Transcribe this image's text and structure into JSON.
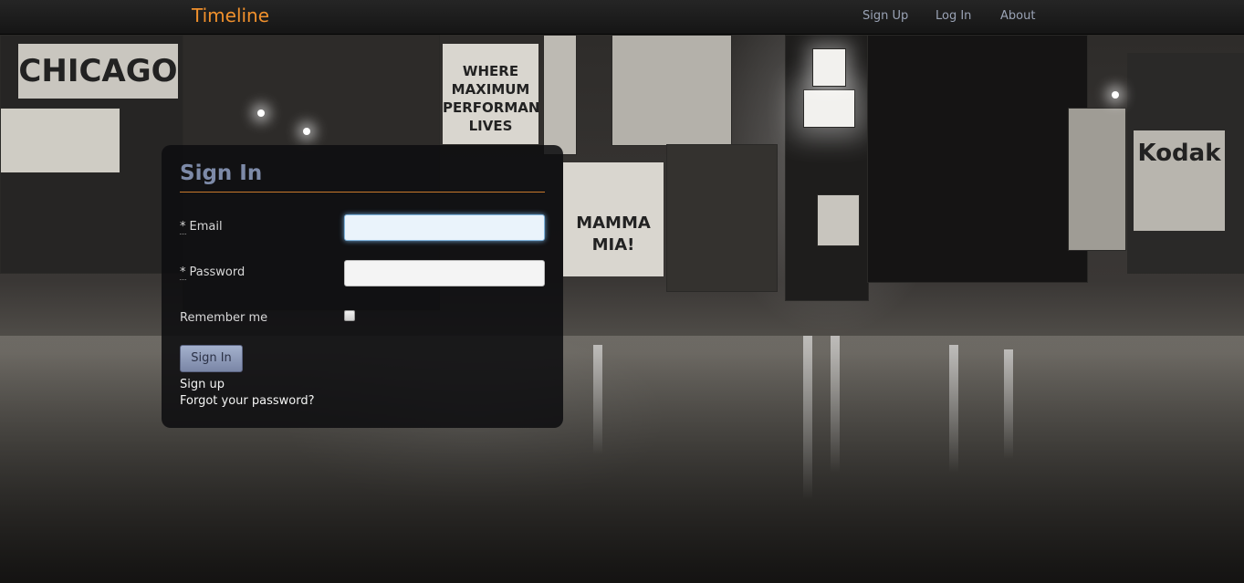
{
  "navbar": {
    "brand": "Timeline",
    "links": [
      "Sign Up",
      "Log In",
      "About"
    ]
  },
  "background": {
    "sign_chicago": "CHICAGO",
    "sign_maximum": "WHERE MAXIMUM PERFORMANCE LIVES",
    "sign_kodak": "Kodak",
    "sign_mamma": "MAMMA MIA!"
  },
  "sign_in": {
    "title": "Sign In",
    "email_label": "Email",
    "password_label": "Password",
    "required_marker": "*",
    "email_value": "",
    "password_value": "",
    "remember_label": "Remember me",
    "remember_checked": false,
    "submit_label": "Sign In",
    "sign_up_link": "Sign up",
    "forgot_link": "Forgot your password?"
  },
  "colors": {
    "brand": "#f0902c",
    "title": "#7d8aa8",
    "rule": "#c8792c",
    "button": "#8e9aba"
  }
}
